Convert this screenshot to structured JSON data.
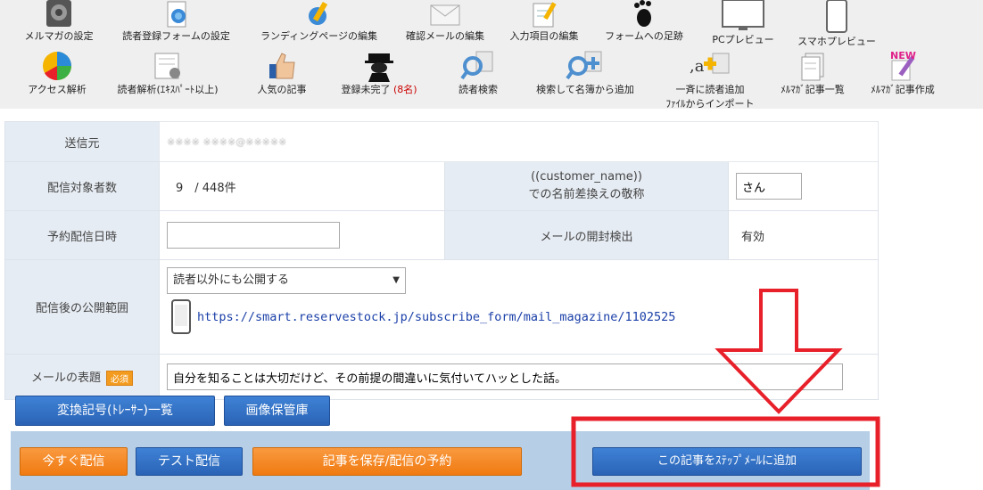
{
  "toolbar": {
    "row1": [
      {
        "label": "メルマガの設定",
        "icon": "settings-gear-icon"
      },
      {
        "label": "読者登録フォームの設定",
        "icon": "form-globe-icon"
      },
      {
        "label": "ランディングページの編集",
        "icon": "pencil-globe-icon"
      },
      {
        "label": "確認メールの編集",
        "icon": "envelope-icon"
      },
      {
        "label": "入力項目の編集",
        "icon": "notepad-pencil-icon"
      },
      {
        "label": "フォームへの足跡",
        "icon": "footprint-icon"
      },
      {
        "label": "PCプレビュー",
        "icon": "monitor-icon"
      },
      {
        "label": "スマホプレビュー",
        "icon": "smartphone-icon"
      }
    ],
    "row2": [
      {
        "label": "アクセス解析",
        "icon": "pie-chart-icon"
      },
      {
        "label": "読者解析(ｴｷｽﾊﾟｰﾄ以上)",
        "icon": "analysis-sheet-icon"
      },
      {
        "label": "人気の記事",
        "icon": "thumbs-up-icon"
      },
      {
        "label": "登録未完了",
        "count": "(8名)",
        "icon": "spy-icon"
      },
      {
        "label": "読者検索",
        "icon": "magnifier-news-icon"
      },
      {
        "label": "検索して名簿から追加",
        "icon": "magnifier-add-icon"
      },
      {
        "label": "一斉に読者追加",
        "sub": "ﾌｧｲﾙからインポート",
        "icon": "add-news-icon"
      },
      {
        "label": "ﾒﾙﾏｶﾞ記事一覧",
        "icon": "documents-icon"
      },
      {
        "label": "ﾒﾙﾏｶﾞ記事作成",
        "badge": "NEW",
        "icon": "new-pencil-icon"
      }
    ]
  },
  "form": {
    "sender_label": "送信元",
    "sender_value": "※※※※ ※※※※@※※※※※",
    "target_label": "配信対象者数",
    "target_value": "9　/ 448件",
    "honorific_label_1": "((customer_name))",
    "honorific_label_2": "での名前差換えの敬称",
    "honorific_value": "さん",
    "schedule_label": "予約配信日時",
    "schedule_value": "",
    "open_detect_label": "メールの開封検出",
    "open_detect_value": "有効",
    "publish_label": "配信後の公開範囲",
    "publish_select": "読者以外にも公開する",
    "publish_url": "https://smart.reservestock.jp/subscribe_form/mail_magazine/1102525",
    "subject_label": "メールの表題",
    "required_badge": "必須",
    "subject_value": "自分を知ることは大切だけど、その前提の間違いに気付いてハッとした話。"
  },
  "buttons": {
    "tracer_list": "変換記号(ﾄﾚｰｻｰ)一覧",
    "image_store": "画像保管庫",
    "send_now": "今すぐ配信",
    "test_send": "テスト配信",
    "save_schedule": "記事を保存/配信の予約",
    "add_step_mail": "この記事をｽﾃｯﾌﾟﾒｰﾙに追加"
  },
  "colors": {
    "annotation_red": "#e8202a",
    "button_blue": "#2f6fc4",
    "button_orange": "#f5871f"
  }
}
